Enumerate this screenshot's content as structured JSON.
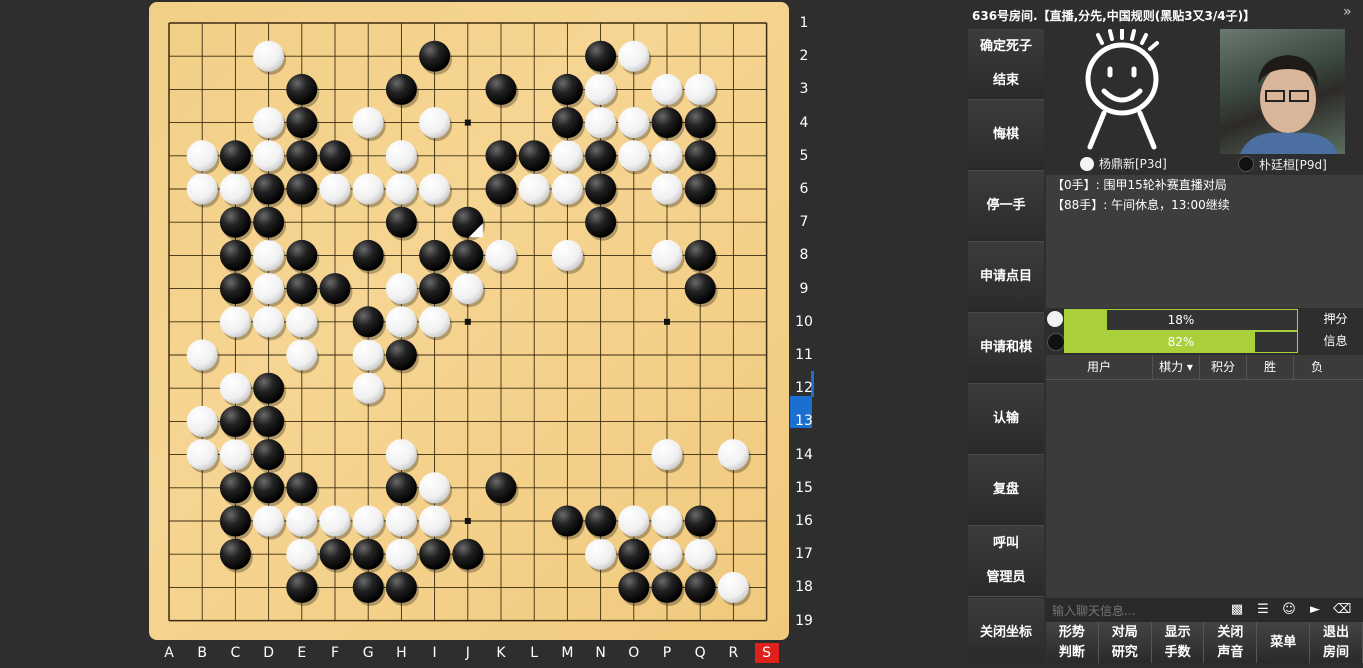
{
  "room": {
    "title": "636号房间.【直播,分先,中国规则(黑贴3又3/4子)】"
  },
  "board": {
    "size": 19,
    "columns": [
      "A",
      "B",
      "C",
      "D",
      "E",
      "F",
      "G",
      "H",
      "I",
      "J",
      "K",
      "L",
      "M",
      "N",
      "O",
      "P",
      "Q",
      "R",
      "S"
    ],
    "rows": [
      "1",
      "2",
      "3",
      "4",
      "5",
      "6",
      "7",
      "8",
      "9",
      "10",
      "11",
      "12",
      "13",
      "14",
      "15",
      "16",
      "17",
      "18",
      "19"
    ],
    "active_column": "S",
    "active_row": "13",
    "last_move": "J7",
    "black_stones": [
      "I2",
      "N2",
      "E3",
      "H3",
      "K3",
      "M3",
      "E4",
      "M4",
      "P4",
      "Q4",
      "C5",
      "E5",
      "F5",
      "K5",
      "L5",
      "N5",
      "Q5",
      "D6",
      "E6",
      "K6",
      "N6",
      "Q6",
      "C7",
      "D7",
      "H7",
      "J7",
      "N7",
      "C8",
      "E8",
      "G8",
      "I8",
      "J8",
      "Q8",
      "C9",
      "E9",
      "F9",
      "I9",
      "Q9",
      "G10",
      "H11",
      "D12",
      "C13",
      "D13",
      "D14",
      "C15",
      "D15",
      "E15",
      "H15",
      "K15",
      "C16",
      "M16",
      "N16",
      "Q16",
      "C17",
      "F17",
      "G17",
      "I17",
      "J17",
      "O17",
      "E18",
      "G18",
      "H18",
      "O18",
      "P18",
      "Q18"
    ],
    "white_stones": [
      "D2",
      "O2",
      "N3",
      "P3",
      "Q3",
      "D4",
      "G4",
      "I4",
      "N4",
      "O4",
      "B5",
      "D5",
      "E5x",
      "H5",
      "M5",
      "O5",
      "P5",
      "B6",
      "C6",
      "F6",
      "G6",
      "H6",
      "I6",
      "L6",
      "M6",
      "P6",
      "K8",
      "M8",
      "P8",
      "D8",
      "H9",
      "J9",
      "D9",
      "C10",
      "D10",
      "E10",
      "H10",
      "I10",
      "B11",
      "E11",
      "G11",
      "C12",
      "G12",
      "B13",
      "B14",
      "C14",
      "H14",
      "P14",
      "R14",
      "I15",
      "D16",
      "E16",
      "F16",
      "G16",
      "H16",
      "I16",
      "O16",
      "P16",
      "E17",
      "H17",
      "N17",
      "P17",
      "Q17",
      "R18"
    ]
  },
  "players": {
    "white_name": "杨鼎新[P3d]",
    "black_name": "朴廷桓[P9d]"
  },
  "log": [
    "【0手】: 围甲15轮补赛直播对局",
    "【88手】: 午间休息，13:00继续"
  ],
  "bet": {
    "white_percent": 18,
    "black_percent": 82,
    "white_label": "18%",
    "black_label": "82%",
    "side_top": "押分",
    "side_bottom": "信息"
  },
  "user_table": {
    "headers": [
      "用户",
      "棋力",
      "积分",
      "胜",
      "负"
    ]
  },
  "actions": [
    {
      "l1": "确定死子",
      "l2": "结束"
    },
    {
      "l1": "悔棋",
      "l2": ""
    },
    {
      "l1": "停一手",
      "l2": ""
    },
    {
      "l1": "申请点目",
      "l2": ""
    },
    {
      "l1": "申请和棋",
      "l2": ""
    },
    {
      "l1": "认输",
      "l2": ""
    },
    {
      "l1": "复盘",
      "l2": ""
    },
    {
      "l1": "呼叫",
      "l2": "管理员"
    }
  ],
  "close_coord": "关闭坐标",
  "chat": {
    "placeholder": "输入聊天信息..."
  },
  "bottom_buttons": [
    {
      "l1": "形势",
      "l2": "判断"
    },
    {
      "l1": "对局",
      "l2": "研究"
    },
    {
      "l1": "显示",
      "l2": "手数"
    },
    {
      "l1": "关闭",
      "l2": "声音"
    },
    {
      "l1": "菜单",
      "l2": ""
    },
    {
      "l1": "退出",
      "l2": "房间"
    }
  ]
}
